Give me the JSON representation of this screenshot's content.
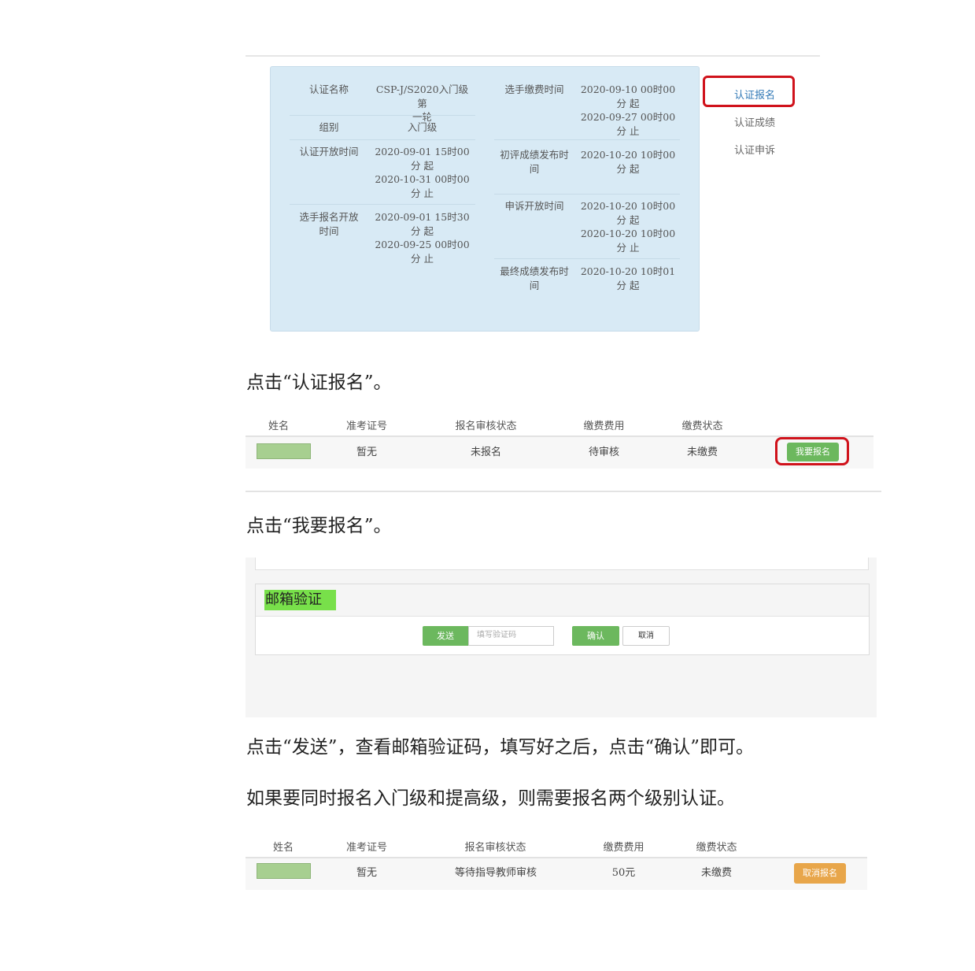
{
  "info_panel": {
    "left": [
      {
        "label": "认证名称",
        "value": "CSP-J/S2020入门级第\n一轮"
      },
      {
        "label": "组别",
        "value": "入门级"
      },
      {
        "label": "认证开放时间",
        "value": "2020-09-01 15时00\n分 起\n2020-10-31 00时00\n分 止"
      },
      {
        "label": "选手报名开放\n时间",
        "value": "2020-09-01 15时30\n分 起\n2020-09-25 00时00\n分 止"
      }
    ],
    "right": [
      {
        "label": "选手缴费时间",
        "value": "2020-09-10 00时00\n分 起\n2020-09-27 00时00\n分 止"
      },
      {
        "label": "初评成绩发布时\n间",
        "value": "2020-10-20 10时00\n分 起"
      },
      {
        "label": "申诉开放时间",
        "value": "2020-10-20 10时00\n分 起\n2020-10-20 10时00\n分 止"
      },
      {
        "label": "最终成绩发布时\n间",
        "value": "2020-10-20 10时01\n分 起"
      }
    ]
  },
  "nav": {
    "items": [
      "认证报名",
      "认证成绩",
      "认证申诉"
    ]
  },
  "prose": {
    "p1": "点击“认证报名”。",
    "p2": "点击“我要报名”。",
    "p3": "点击“发送”，查看邮箱验证码，填写好之后，点击“确认”即可。",
    "p4": "如果要同时报名入门级和提高级，则需要报名两个级别认证。"
  },
  "table1": {
    "headers": [
      "姓名",
      "准考证号",
      "报名审核状态",
      "缴费费用",
      "缴费状态"
    ],
    "row": {
      "exam_id": "暂无",
      "review": "未报名",
      "fee": "待审核",
      "pay_status": "未缴费"
    },
    "button": "我要报名"
  },
  "email_verify": {
    "title": "邮箱验证",
    "send": "发送",
    "placeholder": "填写验证码",
    "confirm": "确认",
    "cancel": "取消"
  },
  "table2": {
    "headers": [
      "姓名",
      "准考证号",
      "报名审核状态",
      "缴费费用",
      "缴费状态"
    ],
    "row": {
      "exam_id": "暂无",
      "review": "等待指导教师审核",
      "fee": "50元",
      "pay_status": "未缴费"
    },
    "button": "取消报名"
  },
  "colors": {
    "highlight_red": "#d0121b",
    "button_green": "#6cb85e",
    "button_orange": "#e8a64a",
    "panel_blue": "#d8eaf5"
  }
}
